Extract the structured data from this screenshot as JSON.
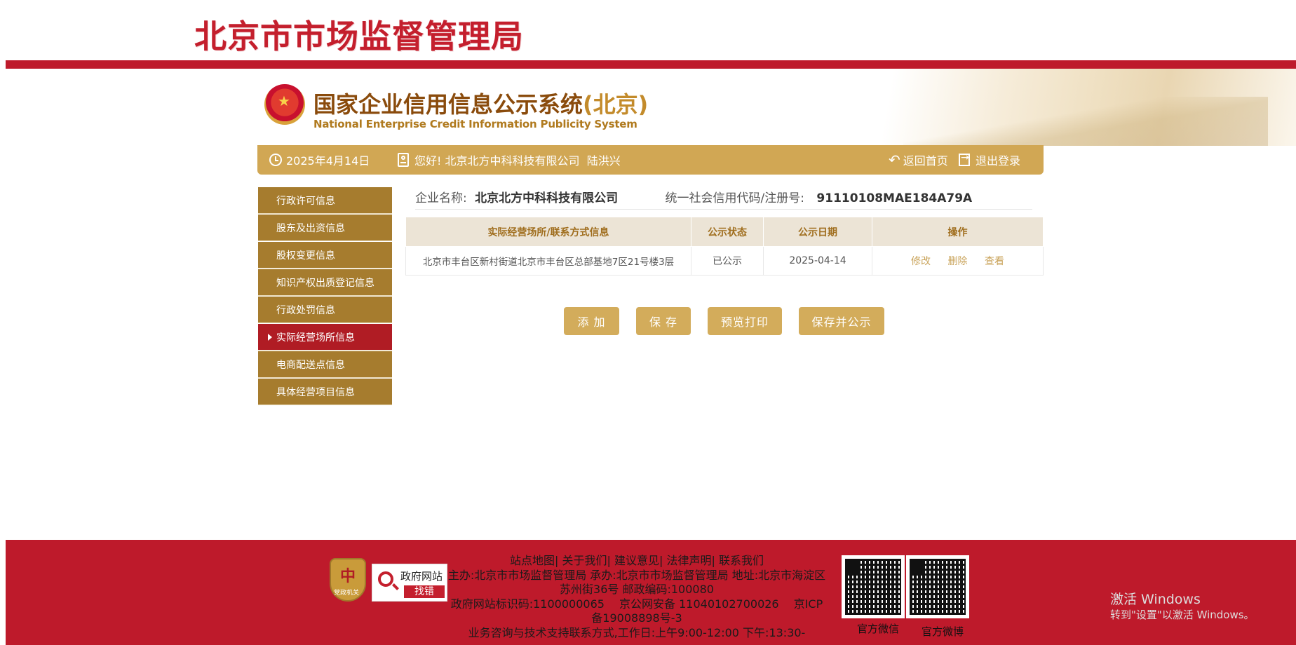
{
  "banner": {
    "title": "北京市市场监督管理局"
  },
  "system": {
    "title": "国家企业信用信息公示系统",
    "title_suffix": "(北京)",
    "subtitle": "National Enterprise Credit Information Publicity System"
  },
  "userbar": {
    "date": "2025年4月14日",
    "greeting": "您好!",
    "company": "北京北方中科科技有限公司",
    "user": "陆洪兴",
    "home_label": "返回首页",
    "logout_label": "退出登录"
  },
  "sidebar": {
    "items": [
      {
        "label": "行政许可信息"
      },
      {
        "label": "股东及出资信息"
      },
      {
        "label": "股权变更信息"
      },
      {
        "label": "知识产权出质登记信息"
      },
      {
        "label": "行政处罚信息"
      },
      {
        "label": "实际经营场所信息",
        "active": true
      },
      {
        "label": "电商配送点信息"
      },
      {
        "label": "具体经营项目信息"
      }
    ]
  },
  "company": {
    "name_label": "企业名称:",
    "name": "北京北方中科科技有限公司",
    "code_label": "统一社会信用代码/注册号:",
    "code": "91110108MAE184A79A"
  },
  "table": {
    "headers": [
      "实际经营场所/联系方式信息",
      "公示状态",
      "公示日期",
      "操作"
    ],
    "rows": [
      {
        "address": "北京市丰台区新村街道北京市丰台区总部基地7区21号楼3层",
        "status": "已公示",
        "date": "2025-04-14",
        "actions": [
          "修改",
          "删除",
          "查看"
        ]
      }
    ]
  },
  "buttons": {
    "add": "添 加",
    "save": "保 存",
    "preview": "预览打印",
    "save_publish": "保存并公示"
  },
  "footer": {
    "links": "站点地图| 关于我们| 建议意见| 法律声明| 联系我们",
    "host": "主办:北京市市场监督管理局 承办:北京市市场监督管理局 地址:北京市海淀区苏州街36号 邮政编码:100080",
    "ids": "政府网站标识码:1100000065　 京公网安备 11040102700026　 京ICP备19008898号-3",
    "support": "业务咨询与技术支持联系方式,工作日:上午9:00-12:00 下午:13:30-",
    "gov_find_error_top": "政府网站",
    "gov_find_error_bottom": "找错",
    "party_label": "党政机关",
    "wechat_label": "官方微信",
    "weibo_label": "官方微博"
  },
  "watermark": {
    "line1": "激活 Windows",
    "line2": "转到\"设置\"以激活 Windows。"
  },
  "colors": {
    "brand_red": "#be1a2b",
    "gold": "#d1a754",
    "sidebar": "#a67c2e",
    "active": "#b01c24"
  }
}
